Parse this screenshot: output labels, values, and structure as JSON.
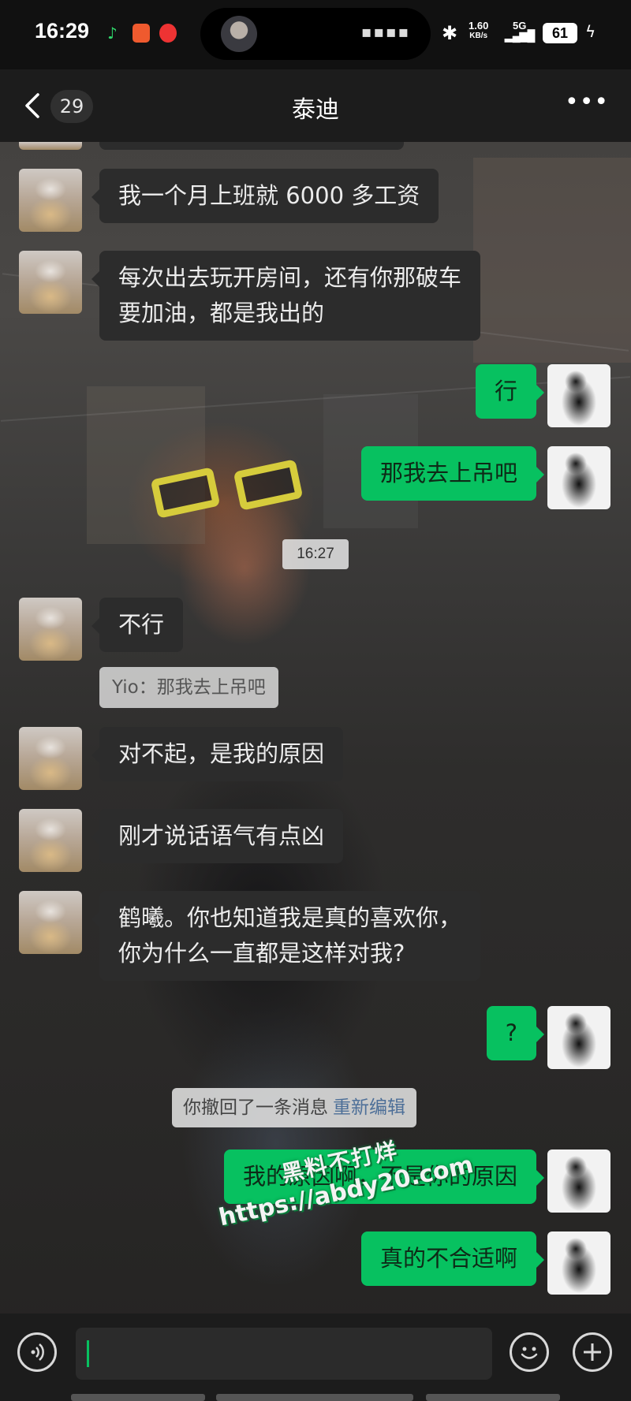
{
  "status_bar": {
    "time": "16:29",
    "net_speed": "1.60",
    "net_unit": "KB/s",
    "network": "5G",
    "battery": "61"
  },
  "header": {
    "back_count": "29",
    "title": "泰迪"
  },
  "messages": [
    {
      "side": "left",
      "text": "我一个月上班就 6000 多工资"
    },
    {
      "side": "left",
      "text": "每次出去玩开房间，还有你那破车",
      "text2": "要加油，都是我出的"
    },
    {
      "side": "right",
      "text": "行"
    },
    {
      "side": "right",
      "text": "那我去上吊吧"
    },
    {
      "side": "left",
      "text": "不行"
    },
    {
      "side": "left",
      "text": "对不起，是我的原因"
    },
    {
      "side": "left",
      "text": "刚才说话语气有点凶"
    },
    {
      "side": "left",
      "text": "鹤曦。你也知道我是真的喜欢你，",
      "text2": "你为什么一直都是这样对我?"
    },
    {
      "side": "right",
      "text": "?"
    },
    {
      "side": "right",
      "text": "我的原因啊，不是你的原因"
    },
    {
      "side": "right",
      "text": "真的不合适啊"
    }
  ],
  "timestamp": "16:27",
  "quote": "Yio：那我去上吊吧",
  "recall": {
    "text": "你撤回了一条消息",
    "edit": "重新编辑"
  },
  "watermark": {
    "line1": "黑料不打烊",
    "line2": "https://abdy20.com"
  },
  "input_bar": {
    "voice_icon": "voice-icon",
    "emoji_icon": "emoji-icon",
    "plus_icon": "plus-icon"
  },
  "colors": {
    "accent_green": "#07c160",
    "left_bubble": "#2c2c2c",
    "header_bg": "#1c1c1c"
  }
}
